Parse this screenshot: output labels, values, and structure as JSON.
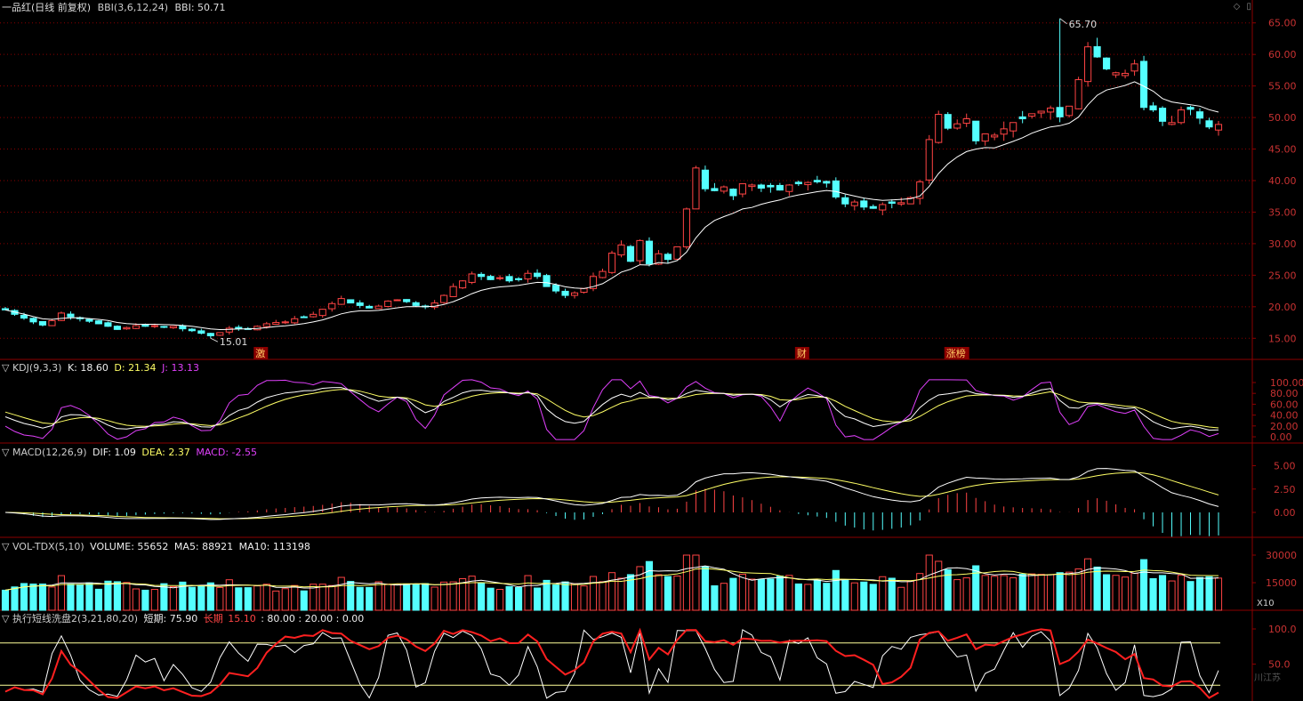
{
  "header": {
    "stock_name": "一品红(日线 前复权)",
    "indicator": "BBI(3,6,12,24)",
    "indicator_value": "BBI: 50.71",
    "icons": [
      "diamond-icon",
      "menu-icon"
    ]
  },
  "colors": {
    "up": "#ff4444",
    "down": "#54ffff",
    "grid": "#8b0000",
    "axis_text": "#c83232",
    "bbi_line": "#ffffff",
    "k_line": "#ffffff",
    "d_line": "#ffff66",
    "j_line": "#e040fb"
  },
  "main_chart": {
    "y_ticks": [
      "65.00",
      "60.00",
      "55.00",
      "50.00",
      "45.00",
      "40.00",
      "35.00",
      "30.00",
      "25.00",
      "20.00",
      "15.00"
    ],
    "ylim": [
      12.5,
      67.5
    ],
    "high_label": "65.70",
    "low_label": "15.01",
    "markers": [
      {
        "label": "激",
        "index": 27
      },
      {
        "label": "财",
        "index": 85
      },
      {
        "label": "涨榜",
        "index": 101
      }
    ]
  },
  "kdj": {
    "title": "KDJ(9,3,3)",
    "k": "K: 18.60",
    "d": "D: 21.34",
    "j": "J: 13.13",
    "y_ticks": [
      "100.00",
      "80.00",
      "60.00",
      "40.00",
      "20.00",
      "0.00"
    ]
  },
  "macd": {
    "title": "MACD(12,26,9)",
    "dif": "DIF: 1.09",
    "dea": "DEA: 2.37",
    "macd": "MACD: -2.55",
    "y_ticks": [
      "5.00",
      "2.50",
      "0.00"
    ]
  },
  "vol": {
    "title": "VOL-TDX(5,10)",
    "volume": "VOLUME: 55652",
    "ma5": "MA5: 88921",
    "ma10": "MA10: 113198",
    "y_ticks": [
      "30000",
      "15000"
    ],
    "unit": "X10"
  },
  "wash": {
    "title": "执行短线洗盘2(3,21,80,20)",
    "short": "短期: 75.90",
    "long_label": "长期",
    "long_value": "15.10",
    "levels": ": 80.00  : 20.00  : 0.00",
    "y_ticks": [
      "100.0",
      "50.0"
    ]
  },
  "watermark": "川江苏",
  "chart_data": {
    "type": "candlestick",
    "close_series": [
      19.5,
      18.8,
      18.2,
      17.6,
      17.1,
      17.8,
      19.0,
      18.4,
      18.1,
      17.7,
      17.3,
      16.9,
      16.4,
      16.7,
      17.0,
      16.9,
      17.0,
      16.8,
      16.9,
      16.5,
      16.2,
      15.8,
      15.4,
      15.9,
      16.6,
      16.5,
      16.4,
      16.9,
      17.3,
      17.5,
      17.6,
      18.1,
      18.3,
      18.8,
      19.6,
      20.5,
      21.3,
      20.6,
      20.2,
      19.8,
      20.1,
      20.9,
      21.1,
      20.8,
      20.2,
      20.0,
      20.6,
      21.8,
      23.2,
      24.1,
      25.2,
      24.8,
      24.3,
      24.6,
      24.1,
      24.3,
      25.3,
      24.8,
      23.2,
      22.5,
      21.8,
      22.2,
      22.9,
      24.8,
      25.6,
      28.5,
      29.8,
      27.2,
      30.5,
      26.8,
      28.4,
      27.5,
      29.5,
      35.5,
      42.0,
      38.7,
      38.4,
      39.0,
      37.6,
      39.5,
      39.3,
      38.8,
      39.0,
      38.5,
      39.3,
      39.5,
      39.7,
      39.8,
      39.6,
      37.4,
      36.3,
      36.6,
      35.8,
      35.6,
      36.2,
      36.4,
      36.5,
      37.3,
      39.8,
      46.5,
      50.5,
      48.3,
      49.0,
      49.8,
      46.3,
      47.4,
      47.2,
      48.2,
      49.2,
      49.8,
      50.6,
      51.0,
      51.5,
      50.1,
      51.8,
      56.0,
      61.2,
      59.6,
      57.7,
      57.1,
      57.0,
      58.5,
      51.6,
      51.2,
      49.4,
      49.2,
      51.2,
      51.3,
      49.9,
      48.5,
      48.9
    ]
  }
}
